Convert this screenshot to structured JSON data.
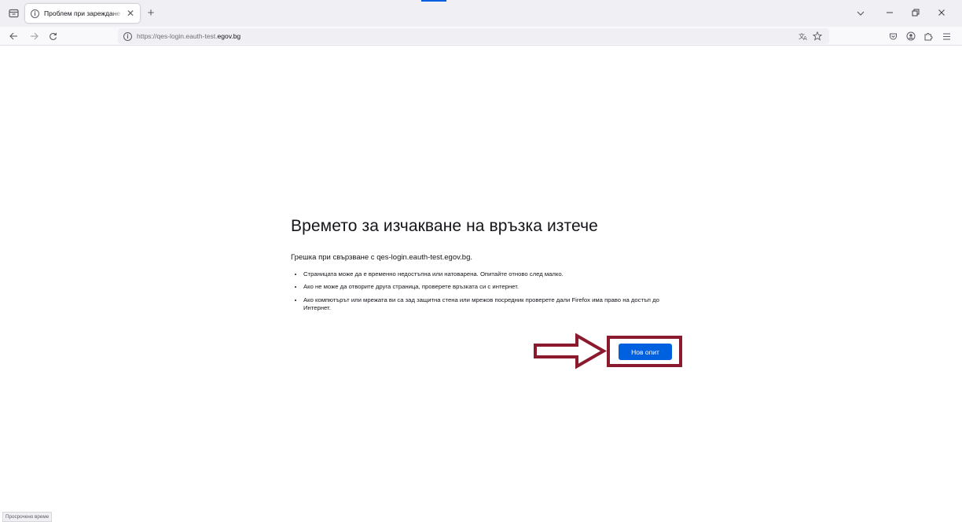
{
  "browser": {
    "tab": {
      "title": "Проблем при зареждане на стр",
      "icon": "info-icon",
      "close_label": "✕"
    },
    "new_tab_label": "+",
    "url": {
      "prefix": "https://qes-login.eauth-test.",
      "domain": "egov.bg"
    },
    "icons": {
      "back": "arrow-left-icon",
      "forward": "arrow-right-icon",
      "reload": "reload-icon",
      "translate": "translate-icon",
      "bookmark": "star-icon",
      "pocket": "pocket-icon",
      "account": "account-icon",
      "extensions": "extensions-icon",
      "menu": "hamburger-menu-icon"
    }
  },
  "error_page": {
    "title": "Времето за изчакване на връзка изтече",
    "description": "Грешка при свързване с qes-login.eauth-test.egov.bg.",
    "bullets": [
      "Страницата може да е временно недостъпна или натоварена. Опитайте отново след малко.",
      "Ако не може да отворите друга страница, проверете връзката си с интернет.",
      "Ако компютърът или мрежата ви са зад защитна стена или мрежов посредник проверете дали Firefox има право на достъп до Интернет."
    ],
    "retry_button": "Нов опит"
  },
  "annotation": {
    "color": "#8b1a2f"
  },
  "status_text": "Просрочено време",
  "colors": {
    "accent": "#0061e0",
    "annotation": "#8b1a2f"
  }
}
